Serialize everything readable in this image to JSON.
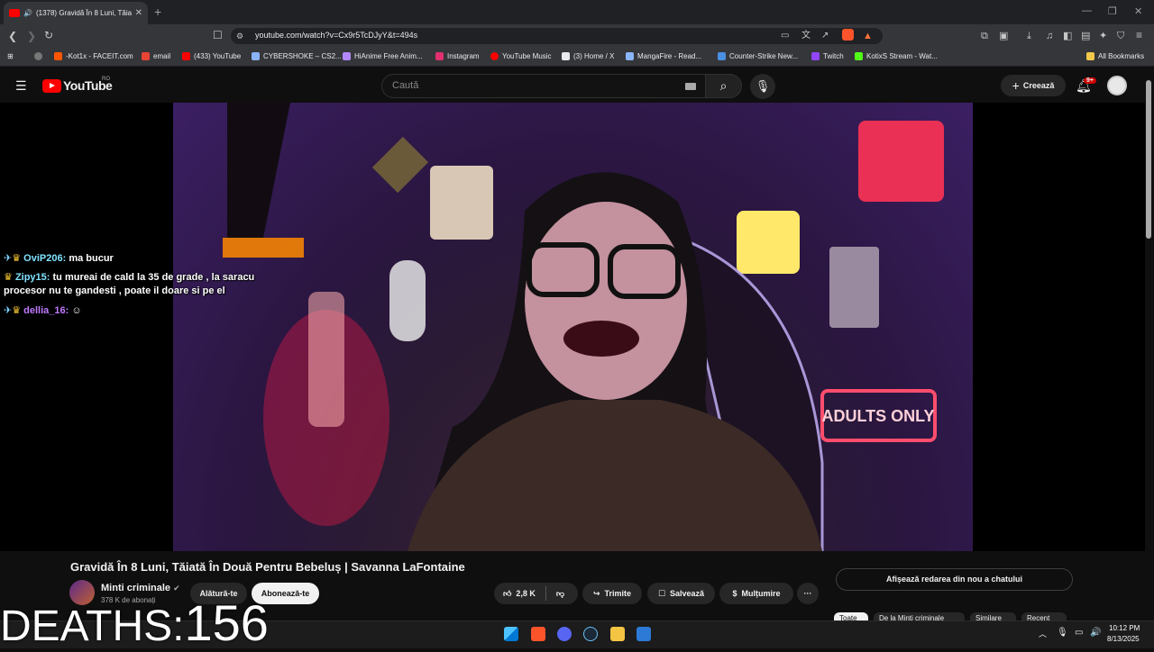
{
  "browser": {
    "tab": {
      "title": "(1378) Gravidă În 8 Luni, Tăiat",
      "close": "✕"
    },
    "new_tab": "+",
    "url": "youtube.com/watch?v=Cx9r5TcDJyY&t=494s",
    "bookmarks": [
      {
        "label": "-Kot1x - FACEIT.com",
        "color": "#ff5500"
      },
      {
        "label": "email",
        "color": "#ea4335"
      },
      {
        "label": "(433) YouTube",
        "color": "#ff0000"
      },
      {
        "label": "CYBERSHOKE – CS2...",
        "color": "#8ab4f8"
      },
      {
        "label": "HiAnime Free Anim...",
        "color": "#b388ff"
      },
      {
        "label": "Instagram",
        "color": "#e1306c"
      },
      {
        "label": "YouTube Music",
        "color": "#ff0000"
      },
      {
        "label": "(3) Home / X",
        "color": "#e8eaed"
      },
      {
        "label": "MangaFire - Read...",
        "color": "#8ab4f8"
      },
      {
        "label": "Counter-Strike New...",
        "color": "#4a90e2"
      },
      {
        "label": "Twitch",
        "color": "#9146ff"
      },
      {
        "label": "KotixS Stream - Wat...",
        "color": "#53fc18"
      }
    ],
    "all_bookmarks": "All Bookmarks"
  },
  "youtube": {
    "logo": "YouTube",
    "region": "RO",
    "search_placeholder": "Caută",
    "create_label": "Creează",
    "notifications_badge": "9+"
  },
  "overlay": {
    "chat": [
      {
        "user": "OviP206:",
        "msg": "ma bucur",
        "color": "#7fe3ff"
      },
      {
        "user": "Zipy15:",
        "msg": "tu mureai de cald la 35 de grade , la saracu",
        "color": "#7fe3ff"
      },
      {
        "user": "",
        "msg": "procesor nu te gandesti , poate il doare si pe el",
        "color": "#fff"
      },
      {
        "user": "dellia_16:",
        "msg": "",
        "color": "#c07bff"
      }
    ],
    "deaths_label": "DEATHS:",
    "deaths_value": "156"
  },
  "video": {
    "title": "Gravidă În 8 Luni, Tăiată În Două Pentru Bebeluș | Savanna LaFontaine",
    "channel": "Minti criminale",
    "subscribers": "378 K de abonați",
    "join_label": "Alătură-te",
    "subscribe_label": "Abonează-te",
    "likes": "2,8 K",
    "share_label": "Trimite",
    "save_label": "Salvează",
    "thanks_label": "Mulțumire",
    "more_label": "···",
    "neon_sign": "ADULTS ONLY"
  },
  "sidebar": {
    "chat_replay": "Afișează redarea din nou a chatului",
    "chips": [
      "Toate",
      "De la Minti criminale",
      "Similare",
      "Recent"
    ]
  },
  "taskbar": {
    "time": "10:12 PM",
    "date": "8/13/2025"
  }
}
